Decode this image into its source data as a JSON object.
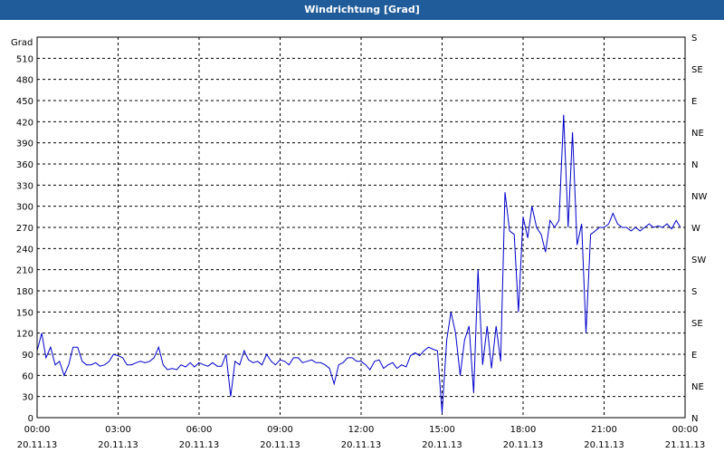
{
  "window": {
    "title": "Windrichtung [Grad]"
  },
  "colors": {
    "titlebar": "#1f5c99",
    "series": "#0000cc",
    "grid": "#000000"
  },
  "chart_data": {
    "type": "line",
    "title": "Windrichtung [Grad]",
    "ylabel": "Grad",
    "ylim": [
      0,
      540
    ],
    "yticks": [
      0,
      30,
      60,
      90,
      120,
      150,
      180,
      210,
      240,
      270,
      300,
      330,
      360,
      390,
      420,
      450,
      480,
      510
    ],
    "right_axis_labels": [
      "N",
      "NE",
      "E",
      "SE",
      "S",
      "SW",
      "W",
      "NW",
      "N",
      "NE",
      "E",
      "SE",
      "S"
    ],
    "xlim": [
      0,
      24
    ],
    "xticks": [
      {
        "h": 0,
        "time": "00:00",
        "date": "20.11.13"
      },
      {
        "h": 3,
        "time": "03:00",
        "date": "20.11.13"
      },
      {
        "h": 6,
        "time": "06:00",
        "date": "20.11.13"
      },
      {
        "h": 9,
        "time": "09:00",
        "date": "20.11.13"
      },
      {
        "h": 12,
        "time": "12:00",
        "date": "20.11.13"
      },
      {
        "h": 15,
        "time": "15:00",
        "date": "20.11.13"
      },
      {
        "h": 18,
        "time": "18:00",
        "date": "20.11.13"
      },
      {
        "h": 21,
        "time": "21:00",
        "date": "20.11.13"
      },
      {
        "h": 24,
        "time": "00:00",
        "date": "21.11.13"
      }
    ],
    "grid": true,
    "series": [
      {
        "x": [
          0.0,
          0.17,
          0.33,
          0.5,
          0.67,
          0.83,
          1.0,
          1.17,
          1.33,
          1.5,
          1.67,
          1.83,
          2.0,
          2.17,
          2.33,
          2.5,
          2.67,
          2.83,
          3.0,
          3.17,
          3.33,
          3.5,
          3.67,
          3.83,
          4.0,
          4.17,
          4.33,
          4.5,
          4.67,
          4.83,
          5.0,
          5.17,
          5.33,
          5.5,
          5.67,
          5.83,
          6.0,
          6.17,
          6.33,
          6.5,
          6.67,
          6.83,
          7.0,
          7.17,
          7.33,
          7.5,
          7.67,
          7.83,
          8.0,
          8.17,
          8.33,
          8.5,
          8.67,
          8.83,
          9.0,
          9.17,
          9.33,
          9.5,
          9.67,
          9.83,
          10.0,
          10.17,
          10.33,
          10.5,
          10.67,
          10.83,
          11.0,
          11.17,
          11.33,
          11.5,
          11.67,
          11.83,
          12.0,
          12.17,
          12.33,
          12.5,
          12.67,
          12.83,
          13.0,
          13.17,
          13.33,
          13.5,
          13.67,
          13.83,
          14.0,
          14.17,
          14.33,
          14.5,
          14.67,
          14.83,
          15.0,
          15.17,
          15.33,
          15.5,
          15.67,
          15.83,
          16.0,
          16.17,
          16.33,
          16.5,
          16.67,
          16.83,
          17.0,
          17.17,
          17.33,
          17.5,
          17.67,
          17.83,
          18.0,
          18.17,
          18.33,
          18.5,
          18.67,
          18.83,
          19.0,
          19.17,
          19.33,
          19.5,
          19.67,
          19.83,
          20.0,
          20.17,
          20.33,
          20.5,
          20.67,
          20.83,
          21.0,
          21.17,
          21.33,
          21.5,
          21.67,
          21.83,
          22.0,
          22.17,
          22.33,
          22.5,
          22.67,
          22.83,
          23.0,
          23.17,
          23.33,
          23.5,
          23.67,
          23.83
        ],
        "y": [
          95,
          120,
          85,
          100,
          75,
          80,
          60,
          75,
          100,
          100,
          80,
          75,
          75,
          78,
          73,
          75,
          80,
          90,
          88,
          85,
          75,
          75,
          78,
          80,
          78,
          80,
          85,
          100,
          75,
          68,
          70,
          68,
          75,
          72,
          78,
          72,
          78,
          75,
          73,
          78,
          73,
          73,
          90,
          30,
          80,
          75,
          95,
          82,
          78,
          80,
          75,
          90,
          80,
          75,
          82,
          80,
          75,
          85,
          85,
          78,
          80,
          82,
          78,
          78,
          75,
          70,
          48,
          75,
          78,
          85,
          85,
          80,
          80,
          75,
          68,
          80,
          82,
          70,
          75,
          78,
          70,
          75,
          72,
          88,
          92,
          88,
          95,
          100,
          97,
          95,
          7,
          110,
          150,
          120,
          60,
          110,
          130,
          35,
          210,
          75,
          130,
          70,
          130,
          80,
          320,
          265,
          260,
          150,
          285,
          255,
          300,
          270,
          260,
          235,
          280,
          270,
          280,
          430,
          270,
          405,
          245,
          275,
          120,
          260,
          265,
          270,
          270,
          275,
          290,
          275,
          270,
          270,
          265,
          270,
          265,
          270,
          275,
          270,
          272,
          270,
          275,
          268,
          280,
          270
        ]
      }
    ]
  }
}
